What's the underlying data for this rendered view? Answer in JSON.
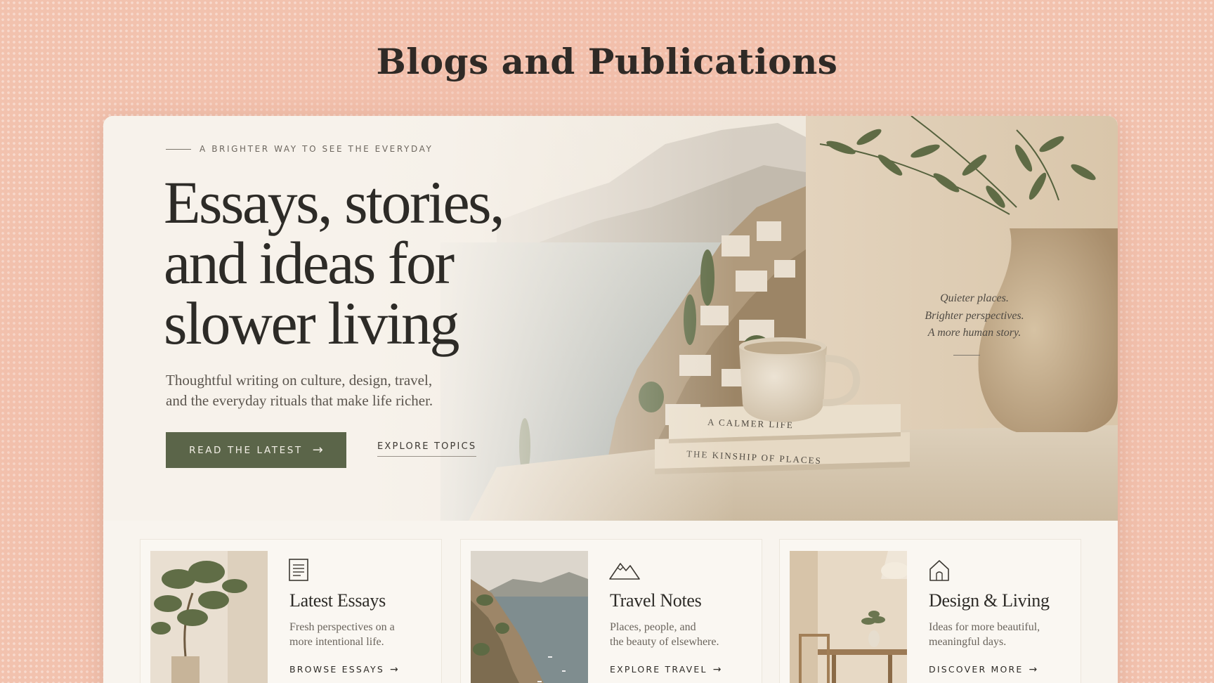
{
  "page": {
    "title": "Blogs and Publications"
  },
  "hero": {
    "eyebrow": "A BRIGHTER WAY TO SEE THE EVERYDAY",
    "heading_lines": [
      "Essays, stories,",
      "and ideas for",
      "slower living"
    ],
    "subtext_lines": [
      "Thoughtful writing on culture, design, travel,",
      "and the everyday rituals that make life richer."
    ],
    "primary_cta": "READ THE LATEST",
    "secondary_cta": "EXPLORE TOPICS",
    "quote_lines": [
      "Quieter places.",
      "Brighter perspectives.",
      "A more human story."
    ],
    "book_titles": [
      "A CALMER LIFE",
      "THE KINSHIP OF PLACES"
    ],
    "accent_color": "#5b6549"
  },
  "cards": [
    {
      "icon": "document-icon",
      "title": "Latest Essays",
      "desc_lines": [
        "Fresh perspectives on a",
        "more intentional life."
      ],
      "link": "BROWSE ESSAYS"
    },
    {
      "icon": "mountain-icon",
      "title": "Travel Notes",
      "desc_lines": [
        "Places, people, and",
        "the beauty of elsewhere."
      ],
      "link": "EXPLORE TRAVEL"
    },
    {
      "icon": "home-icon",
      "title": "Design & Living",
      "desc_lines": [
        "Ideas for more beautiful,",
        "meaningful days."
      ],
      "link": "DISCOVER MORE"
    }
  ],
  "arrow_glyph": "→"
}
